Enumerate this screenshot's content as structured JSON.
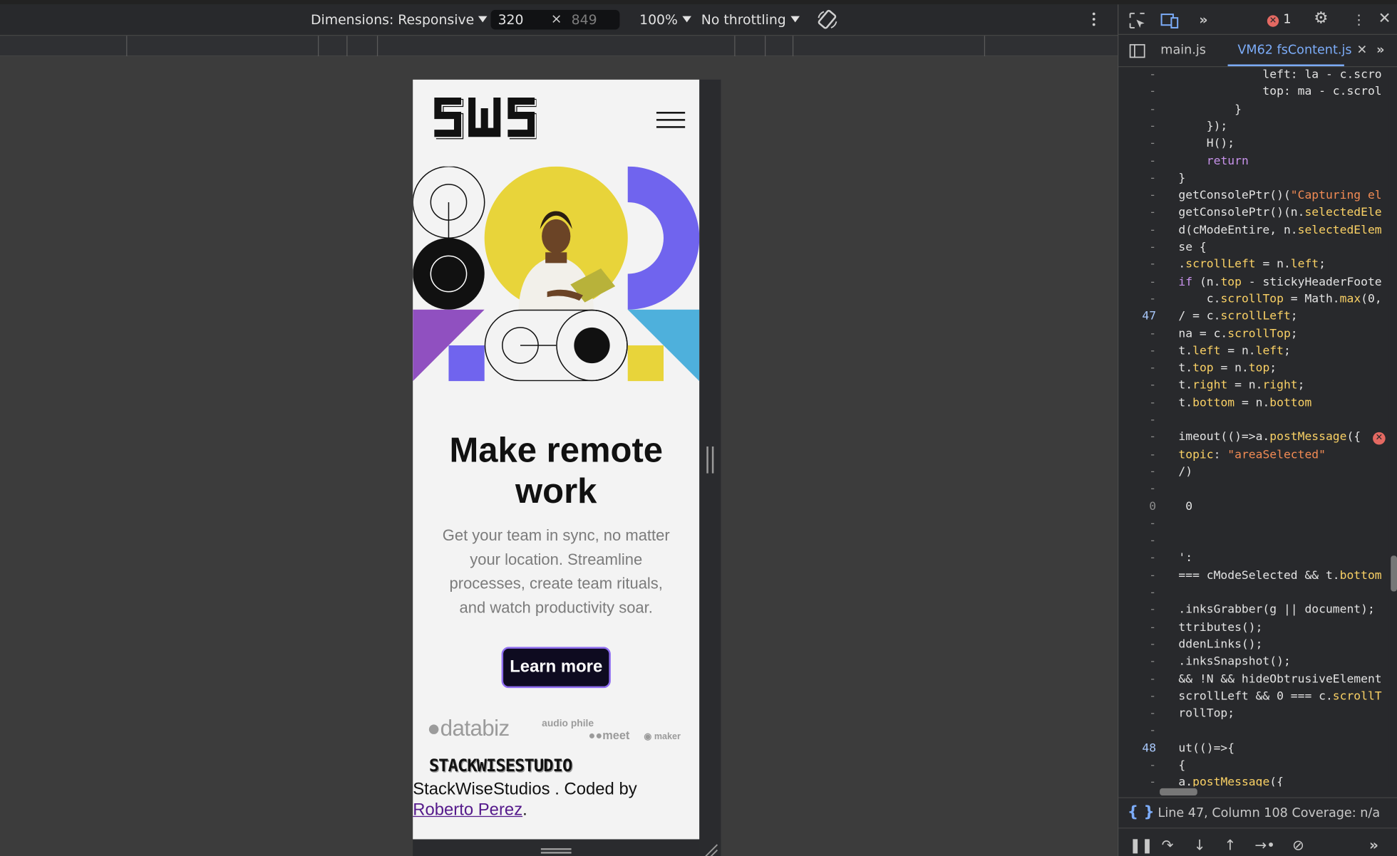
{
  "toolbar": {
    "dimensions_label": "Dimensions: Responsive",
    "width": "320",
    "times": "×",
    "height": "849",
    "zoom": "100%",
    "throttling": "No throttling"
  },
  "page": {
    "logo_text": "SWS",
    "hero_title": "Make remote work",
    "hero_text": "Get your team in sync, no matter your location. Streamline processes, create team rituals, and watch productivity soar.",
    "cta_label": "Learn more",
    "clients": [
      "databiz",
      "audio phile",
      "meet",
      "maker"
    ],
    "footer_logo": "STACKWISESTUDIO",
    "footer_text": "StackWiseStudios . Coded by ",
    "footer_link": "Roberto Perez",
    "footer_period": ".",
    "colors": {
      "yellow": "#e8d43a",
      "indigo": "#7064ee",
      "purple": "#9050c0",
      "sky": "#4eb0dc",
      "dark": "#111111",
      "cta_bg": "#0e0b20",
      "cta_border": "#8e6df0"
    }
  },
  "devtools": {
    "error_count": "1",
    "tabs": [
      "main.js",
      "VM62 fsContent.js"
    ],
    "line_numbers": [
      "-",
      "-",
      "-",
      "-",
      "-",
      "-",
      "-",
      "-",
      "-",
      "-",
      "-",
      "-",
      "-",
      "-",
      "47",
      "-",
      "-",
      "-",
      "-",
      "-",
      "-",
      "-",
      "-",
      "-",
      "-",
      "0",
      "-",
      "-",
      "-",
      "-",
      "-",
      "-",
      "-",
      "-",
      "-",
      "-",
      "-",
      "-",
      "-",
      "48",
      "-"
    ],
    "code_lines": [
      "            left: la - c.scro",
      "            top: ma - c.scrol",
      "        }",
      "    });",
      "    H();",
      "    return",
      "}",
      "getConsolePtr()(\"Capturing el",
      "getConsolePtr()(n.selectedEle",
      "d(cModeEntire, n.selectedElem",
      "se {",
      ".scrollLeft = n.left;",
      "if (n.top - stickyHeaderFoote",
      "    c.scrollTop = Math.max(0,",
      "/ = c.scrollLeft;",
      "na = c.scrollTop;",
      "t.left = n.left;",
      "t.top = n.top;",
      "t.right = n.right;",
      "t.bottom = n.bottom",
      "",
      "imeout(()=>a.postMessage({",
      "topic: \"areaSelected\"",
      "/)",
      "",
      " 0",
      "",
      "",
      "':",
      "=== cModeSelected && t.bottom",
      "",
      ".inksGrabber(g || document);",
      "ttributes();",
      "ddenLinks();",
      ".inksSnapshot();",
      "&& !N && hideObtrusiveElement",
      "scrollLeft && 0 === c.scrollT",
      "rollTop;",
      "",
      "ut(()=>{",
      "{",
      "a.postMessage({"
    ],
    "status": "Line 47, Column 108  Coverage: n/a"
  }
}
